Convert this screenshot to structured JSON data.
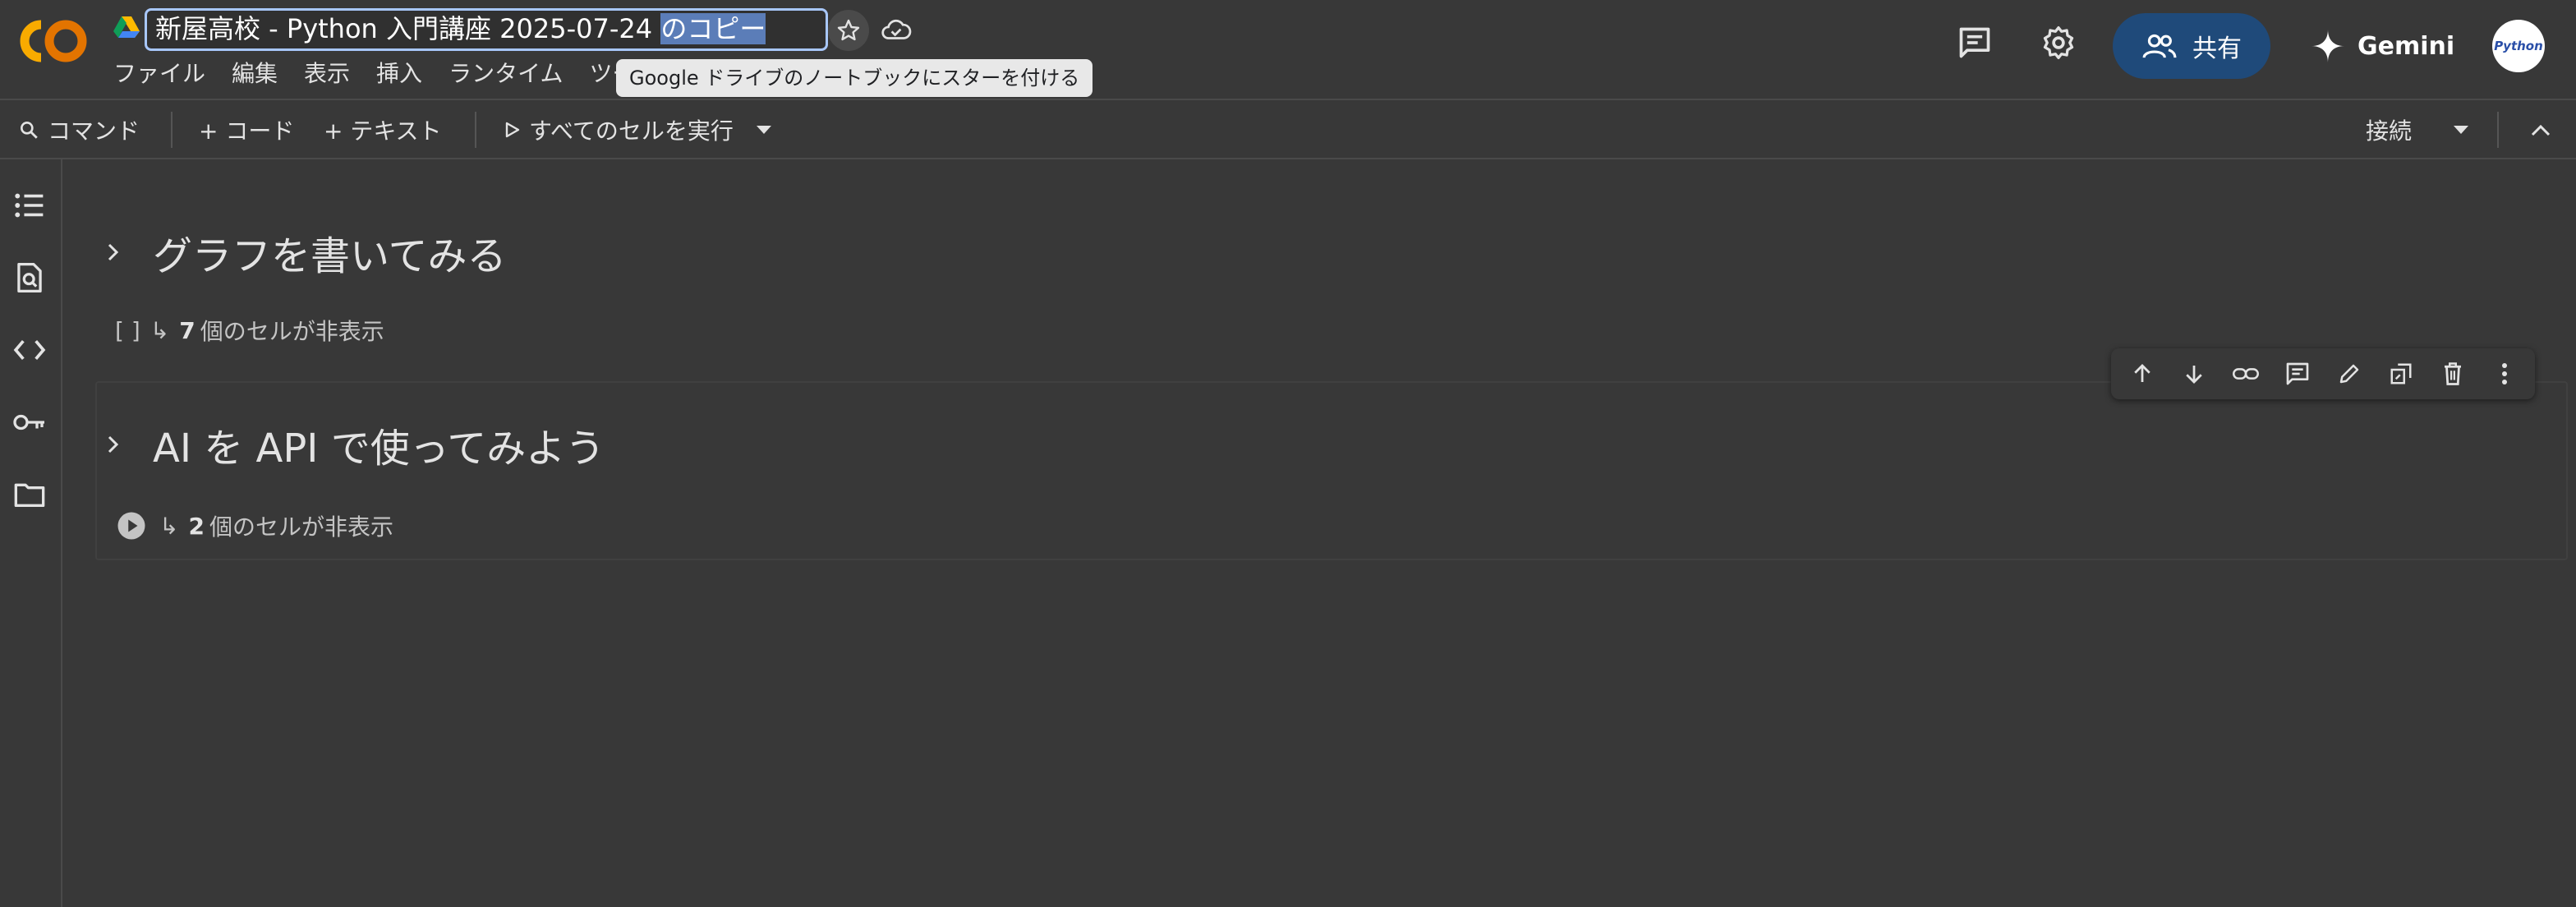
{
  "header": {
    "title_main": "新屋高校 - Python 入門講座 2025-07-24 ",
    "title_selected": "のコピー",
    "tooltip": "Google ドライブのノートブックにスターを付ける",
    "menu": [
      "ファイル",
      "編集",
      "表示",
      "挿入",
      "ランタイム",
      "ツー"
    ],
    "share_label": "共有",
    "gemini_label": "Gemini",
    "avatar_text": "Python"
  },
  "toolbar": {
    "command_label": "コマンド",
    "code_label": "+ コード",
    "text_label": "+ テキスト",
    "run_all_label": "すべてのセルを実行",
    "connect_label": "接続"
  },
  "notebook": {
    "sections": [
      {
        "title": "グラフを書いてみる",
        "hidden_count": "7",
        "hidden_suffix": "個のセルが非表示",
        "prefix": "[ ]"
      },
      {
        "title": "AI を API で使ってみよう",
        "hidden_count": "2",
        "hidden_suffix": "個のセルが非表示"
      }
    ]
  },
  "colors": {
    "background": "#383838",
    "accent": "#a8c7fa",
    "share_bg": "#1f4a7a",
    "logo_orange": "#f9ab00",
    "logo_dark_orange": "#e37400"
  }
}
